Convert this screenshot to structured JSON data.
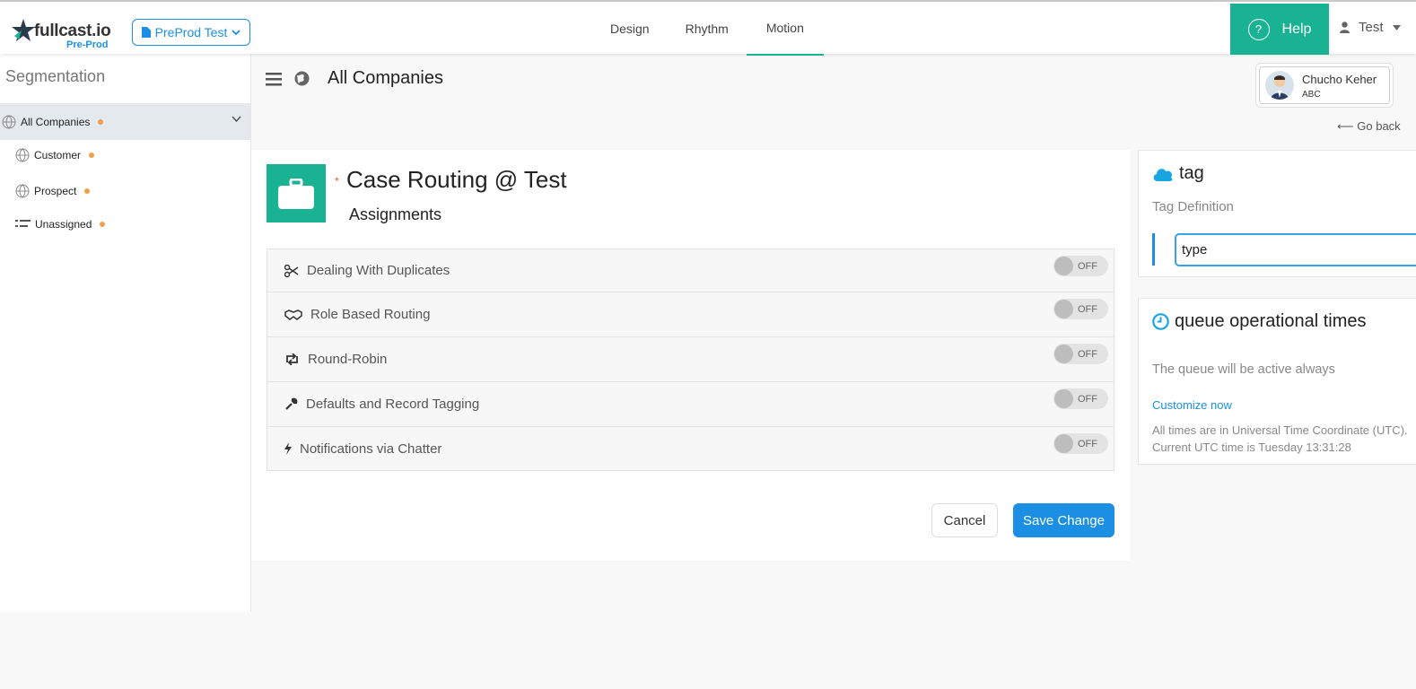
{
  "header": {
    "logo_text": "fullcast.io",
    "logo_sub": "Pre-Prod",
    "env_label": "PreProd Test",
    "nav": [
      {
        "label": "Design",
        "active": false
      },
      {
        "label": "Rhythm",
        "active": false
      },
      {
        "label": "Motion",
        "active": true
      }
    ],
    "help_label": "Help",
    "user_label": "Test"
  },
  "sidebar": {
    "title": "Segmentation",
    "items": [
      {
        "label": "All Companies",
        "icon": "globe-icon",
        "selected": true
      },
      {
        "label": "Customer",
        "icon": "globe-icon"
      },
      {
        "label": "Prospect",
        "icon": "globe-icon"
      },
      {
        "label": "Unassigned",
        "icon": "list-icon"
      }
    ]
  },
  "main": {
    "title": "All Companies",
    "owner_name": "Chucho Keher",
    "owner_org": "ABC",
    "go_back": "Go back",
    "card_title": "Case Routing @ Test",
    "card_subtitle": "Assignments",
    "sections": [
      {
        "label": "Dealing With Duplicates",
        "icon": "scissors-icon",
        "toggle": "OFF"
      },
      {
        "label": "Role Based Routing",
        "icon": "handshake-icon",
        "toggle": "OFF"
      },
      {
        "label": "Round-Robin",
        "icon": "retweet-icon",
        "toggle": "OFF"
      },
      {
        "label": "Defaults and Record Tagging",
        "icon": "wrench-icon",
        "toggle": "OFF"
      },
      {
        "label": "Notifications via Chatter",
        "icon": "bolt-icon",
        "toggle": "OFF"
      }
    ],
    "cancel_label": "Cancel",
    "save_label": "Save Change"
  },
  "tag_panel": {
    "title": "tag",
    "definition_label": "Tag Definition",
    "input_value": "type"
  },
  "queue_panel": {
    "title": "queue operational times",
    "message": "The queue will be active always",
    "customize_label": "Customize now",
    "utc_note": "All times are in Universal Time Coordinate (UTC). Current UTC time is  Tuesday 13:31:28"
  },
  "colors": {
    "accent_green": "#19b394",
    "accent_blue": "#1a8fe3",
    "status_dot": "#f0a04b"
  }
}
